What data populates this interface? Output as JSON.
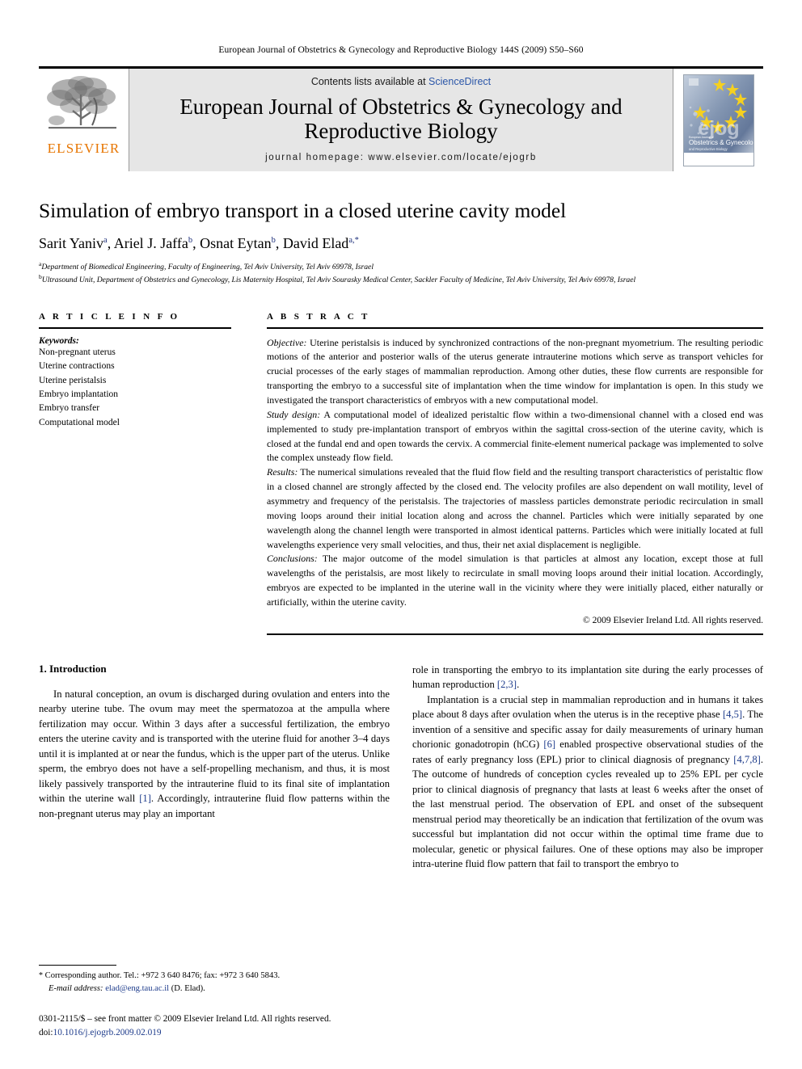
{
  "running_head": "European Journal of Obstetrics & Gynecology and Reproductive Biology 144S (2009) S50–S60",
  "masthead": {
    "contents_prefix": "Contents lists available at ",
    "sciencedirect": "ScienceDirect",
    "journal_title_line1": "European Journal of Obstetrics & Gynecology and",
    "journal_title_line2": "Reproductive Biology",
    "homepage": "journal homepage: www.elsevier.com/locate/ejogrb",
    "publisher": "ELSEVIER",
    "cover": {
      "watermark": "ejog",
      "kicker": "European Journal of",
      "line1": "Obstetrics & Gynecology",
      "line2": "and Reproductive Biology"
    },
    "colors": {
      "panel_bg": "#e6e6e6",
      "link": "#2b56a8",
      "elsevier_orange": "#E77500",
      "star_yellow": "#f5d020"
    }
  },
  "article": {
    "title": "Simulation of embryo transport in a closed uterine cavity model",
    "authors": [
      {
        "name": "Sarit Yaniv",
        "sup": "a"
      },
      {
        "name": "Ariel J. Jaffa",
        "sup": "b"
      },
      {
        "name": "Osnat Eytan",
        "sup": "b"
      },
      {
        "name": "David Elad",
        "sup": "a,*"
      }
    ],
    "affiliations": [
      {
        "sup": "a",
        "text": "Department of Biomedical Engineering, Faculty of Engineering, Tel Aviv University, Tel Aviv 69978, Israel"
      },
      {
        "sup": "b",
        "text": "Ultrasound Unit, Department of Obstetrics and Gynecology, Lis Maternity Hospital, Tel Aviv Sourasky Medical Center, Sackler Faculty of Medicine, Tel Aviv University, Tel Aviv 69978, Israel"
      }
    ]
  },
  "article_info": {
    "label": "A R T I C L E   I N F O",
    "keywords_heading": "Keywords:",
    "keywords": [
      "Non-pregnant uterus",
      "Uterine contractions",
      "Uterine peristalsis",
      "Embryo implantation",
      "Embryo transfer",
      "Computational model"
    ]
  },
  "abstract": {
    "label": "A B S T R A C T",
    "sections": [
      {
        "lead": "Objective:",
        "text": " Uterine peristalsis is induced by synchronized contractions of the non-pregnant myometrium. The resulting periodic motions of the anterior and posterior walls of the uterus generate intrauterine motions which serve as transport vehicles for crucial processes of the early stages of mammalian reproduction. Among other duties, these flow currents are responsible for transporting the embryo to a successful site of implantation when the time window for implantation is open. In this study we investigated the transport characteristics of embryos with a new computational model."
      },
      {
        "lead": "Study design:",
        "text": " A computational model of idealized peristaltic flow within a two-dimensional channel with a closed end was implemented to study pre-implantation transport of embryos within the sagittal cross-section of the uterine cavity, which is closed at the fundal end and open towards the cervix. A commercial finite-element numerical package was implemented to solve the complex unsteady flow field."
      },
      {
        "lead": "Results:",
        "text": " The numerical simulations revealed that the fluid flow field and the resulting transport characteristics of peristaltic flow in a closed channel are strongly affected by the closed end. The velocity profiles are also dependent on wall motility, level of asymmetry and frequency of the peristalsis. The trajectories of massless particles demonstrate periodic recirculation in small moving loops around their initial location along and across the channel. Particles which were initially separated by one wavelength along the channel length were transported in almost identical patterns. Particles which were initially located at full wavelengths experience very small velocities, and thus, their net axial displacement is negligible."
      },
      {
        "lead": "Conclusions:",
        "text": " The major outcome of the model simulation is that particles at almost any location, except those at full wavelengths of the peristalsis, are most likely to recirculate in small moving loops around their initial location. Accordingly, embryos are expected to be implanted in the uterine wall in the vicinity where they were initially placed, either naturally or artificially, within the uterine cavity."
      }
    ],
    "copyright": "© 2009 Elsevier Ireland Ltd. All rights reserved."
  },
  "body": {
    "section_heading": "1. Introduction",
    "left_paragraphs": [
      "In natural conception, an ovum is discharged during ovulation and enters into the nearby uterine tube. The ovum may meet the spermatozoa at the ampulla where fertilization may occur. Within 3 days after a successful fertilization, the embryo enters the uterine cavity and is transported with the uterine fluid for another 3–4 days until it is implanted at or near the fundus, which is the upper part of the uterus. Unlike sperm, the embryo does not have a self-propelling mechanism, and thus, it is most likely passively transported by the intrauterine fluid to its final site of implantation within the uterine wall [1]. Accordingly, intrauterine fluid flow patterns within the non-pregnant uterus may play an important"
    ],
    "right_paragraphs": [
      "role in transporting the embryo to its implantation site during the early processes of human reproduction [2,3].",
      "Implantation is a crucial step in mammalian reproduction and in humans it takes place about 8 days after ovulation when the uterus is in the receptive phase [4,5]. The invention of a sensitive and specific assay for daily measurements of urinary human chorionic gonadotropin (hCG) [6] enabled prospective observational studies of the rates of early pregnancy loss (EPL) prior to clinical diagnosis of pregnancy [4,7,8]. The outcome of hundreds of conception cycles revealed up to 25% EPL per cycle prior to clinical diagnosis of pregnancy that lasts at least 6 weeks after the onset of the last menstrual period. The observation of EPL and onset of the subsequent menstrual period may theoretically be an indication that fertilization of the ovum was successful but implantation did not occur within the optimal time frame due to molecular, genetic or physical failures. One of these options may also be improper intra-uterine fluid flow pattern that fail to transport the embryo to"
    ]
  },
  "footnotes": {
    "corresponding": "Corresponding author. Tel.: +972 3 640 8476; fax: +972 3 640 5843.",
    "email_label": "E-mail address:",
    "email": "elad@eng.tau.ac.il",
    "email_suffix": " (D. Elad).",
    "issn_line": "0301-2115/$ – see front matter © 2009 Elsevier Ireland Ltd. All rights reserved.",
    "doi_label": "doi:",
    "doi": "10.1016/j.ejogrb.2009.02.019"
  }
}
